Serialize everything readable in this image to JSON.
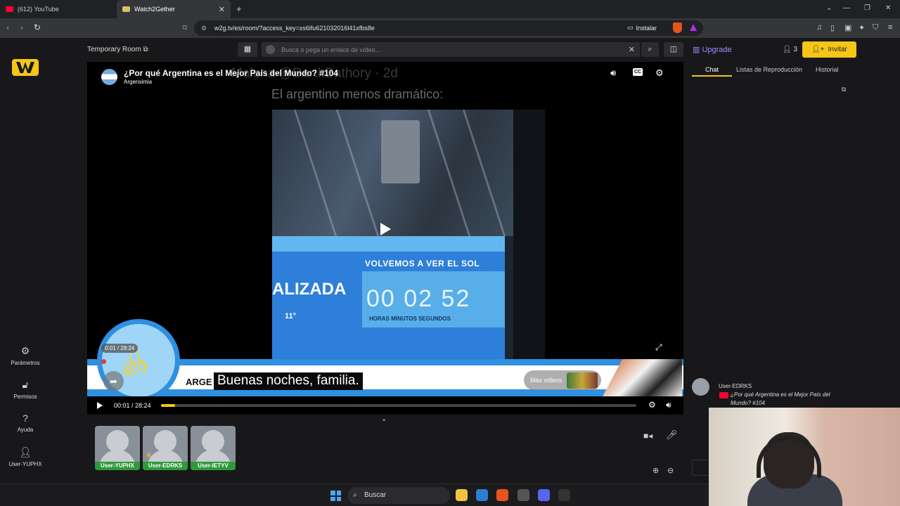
{
  "browser": {
    "tabs": [
      {
        "label": "(612) YouTube",
        "active": false
      },
      {
        "label": "Watch2Gether",
        "active": true
      }
    ],
    "new_tab": "+",
    "window_controls": [
      "⌄",
      "—",
      "❐",
      "✕"
    ],
    "url": "w2g.tv/es/room/?access_key=xs6ifu621032016l41xfbs8e",
    "install_label": "Instalar"
  },
  "app": {
    "room_name": "Temporary Room",
    "search_placeholder": "Busca o pega un enlace de vídeo...",
    "upgrade_label": "Upgrade",
    "user_count": "3",
    "invite_label": "Invitar",
    "nav": [
      {
        "label": "Parámetros",
        "icon": "gear-icon"
      },
      {
        "label": "Permisos",
        "icon": "unlock-icon"
      },
      {
        "label": "Ayuda",
        "icon": "help-icon"
      },
      {
        "label": "User-YUPHX",
        "icon": "user-icon"
      }
    ],
    "sidebar_tabs": [
      "Chat",
      "Listas de Reproducción",
      "Historial"
    ],
    "active_sidebar_tab": "Chat"
  },
  "video": {
    "title": "¿Por qué Argentina es el Mejor País del Mundo? #104",
    "channel": "Argensimia",
    "tweet_header": "Malena @DarthBathory · 2d",
    "tweet_text": "El argentino menos dramático:",
    "screen_text": {
      "heading": "VOLVEMOS A VER EL SOL",
      "timer": "00 02 52",
      "units": "HORAS   MINUTOS   SEGUNDOS",
      "left_word": "ALIZADA",
      "temperature": "11°"
    },
    "overlay_time": "0:01 / 28:24",
    "banner_word": "ARGE",
    "subtitle": "Buenas noches, familia.",
    "more_videos": "Más videos",
    "current_time": "00:01",
    "duration": "28:24",
    "progress": 0.0006
  },
  "participants": [
    "User-YUPHX",
    "User-EDRKS",
    "User-IETYV"
  ],
  "chat": {
    "messages": [
      {
        "user": "User-EDRKS",
        "text": "¿Por qué Argentina es el Mejor País del Mundo? #104"
      }
    ]
  },
  "taskbar": {
    "search_label": "Buscar"
  },
  "colors": {
    "accent": "#f5c518",
    "upgrade": "#a78bfa",
    "participant_tag": "#2e9a3a"
  }
}
